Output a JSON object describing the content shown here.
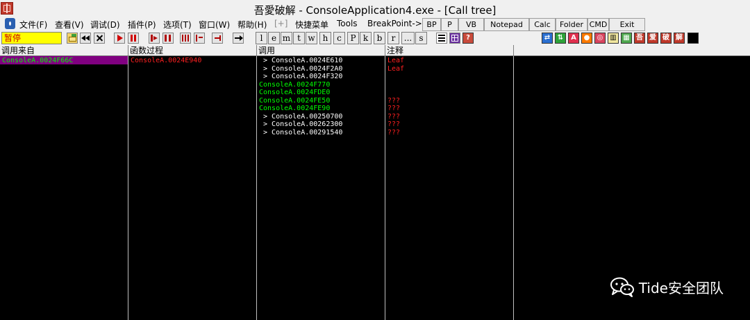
{
  "window": {
    "title": "吾愛破解 - ConsoleApplication4.exe - [Call tree]"
  },
  "menu": [
    "文件(F)",
    "查看(V)",
    "调试(D)",
    "插件(P)",
    "选项(T)",
    "窗口(W)",
    "帮助(H)",
    "[+]",
    "快捷菜单",
    "Tools",
    "BreakPoint->"
  ],
  "quick_buttons": [
    "BP",
    "P",
    "VB",
    "Notepad",
    "Calc",
    "Folder",
    "CMD",
    "Exit"
  ],
  "status": "暂停",
  "toolbar_letters": [
    "l",
    "e",
    "m",
    "t",
    "w",
    "h",
    "c",
    "P",
    "k",
    "b",
    "r",
    "...",
    "s"
  ],
  "custom_icons": [
    "吾",
    "爱",
    "破",
    "解"
  ],
  "columns": [
    "调用来自",
    "函数过程",
    "调用",
    "注释"
  ],
  "rows": {
    "called_from": "ConsoleA.0024F66C",
    "procedure": "ConsoleA.0024E940",
    "calls": [
      {
        "text": " > ConsoleA.0024E610",
        "comment": "Leaf",
        "kind": "child"
      },
      {
        "text": " > ConsoleA.0024F2A0",
        "comment": "Leaf",
        "kind": "child"
      },
      {
        "text": " > ConsoleA.0024F320",
        "comment": "",
        "kind": "child"
      },
      {
        "text": "ConsoleA.0024F770",
        "comment": "",
        "kind": "green"
      },
      {
        "text": "ConsoleA.0024FDE0",
        "comment": "",
        "kind": "green"
      },
      {
        "text": "ConsoleA.0024FE50",
        "comment": "???",
        "kind": "green"
      },
      {
        "text": "ConsoleA.0024FE90",
        "comment": "???",
        "kind": "green"
      },
      {
        "text": " > ConsoleA.00250700",
        "comment": "???",
        "kind": "child"
      },
      {
        "text": " > ConsoleA.00262300",
        "comment": "???",
        "kind": "child"
      },
      {
        "text": " > ConsoleA.00291540",
        "comment": "???",
        "kind": "child"
      }
    ]
  },
  "watermark": "Tide安全团队",
  "colors": {
    "background": "#000000",
    "selected_row": "#800080",
    "green_text": "#00ff00",
    "red_text": "#ff2020",
    "white_text": "#ffffff"
  }
}
